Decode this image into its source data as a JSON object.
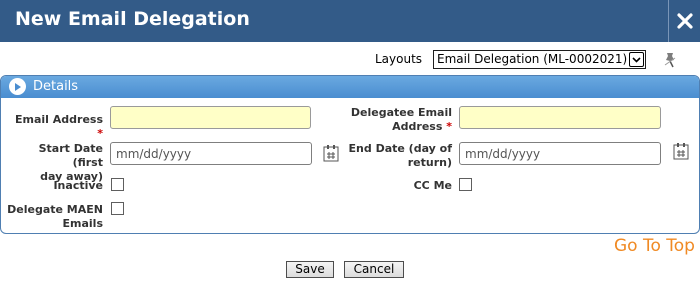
{
  "window": {
    "title": "New Email Delegation"
  },
  "layouts": {
    "label": "Layouts",
    "selected": "Email Delegation (ML-0002021)"
  },
  "section": {
    "title": "Details"
  },
  "fields": {
    "email_address": {
      "label": "Email Address",
      "required_mark": "*",
      "value": ""
    },
    "delegatee_email": {
      "label_line1": "Delegatee Email",
      "label_line2": "Address",
      "required_mark": "*",
      "value": ""
    },
    "start_date": {
      "label_line1": "Start Date (first",
      "label_line2": "day away)",
      "placeholder": "mm/dd/yyyy"
    },
    "end_date": {
      "label_line1": "End Date (day of",
      "label_line2": "return)",
      "placeholder": "mm/dd/yyyy"
    },
    "inactive": {
      "label": "Inactive",
      "checked": false
    },
    "cc_me": {
      "label": "CC Me",
      "checked": false
    },
    "delegate_maen": {
      "label_line1": "Delegate MAEN",
      "label_line2": "Emails",
      "checked": false
    }
  },
  "go_to_top": "Go To Top",
  "buttons": {
    "save": "Save",
    "cancel": "Cancel"
  },
  "colors": {
    "title_bar": "#335b88",
    "panel_header": "#4a8dd0",
    "required_field_bg": "#ffffc7",
    "go_to_top": "#f08a24"
  }
}
